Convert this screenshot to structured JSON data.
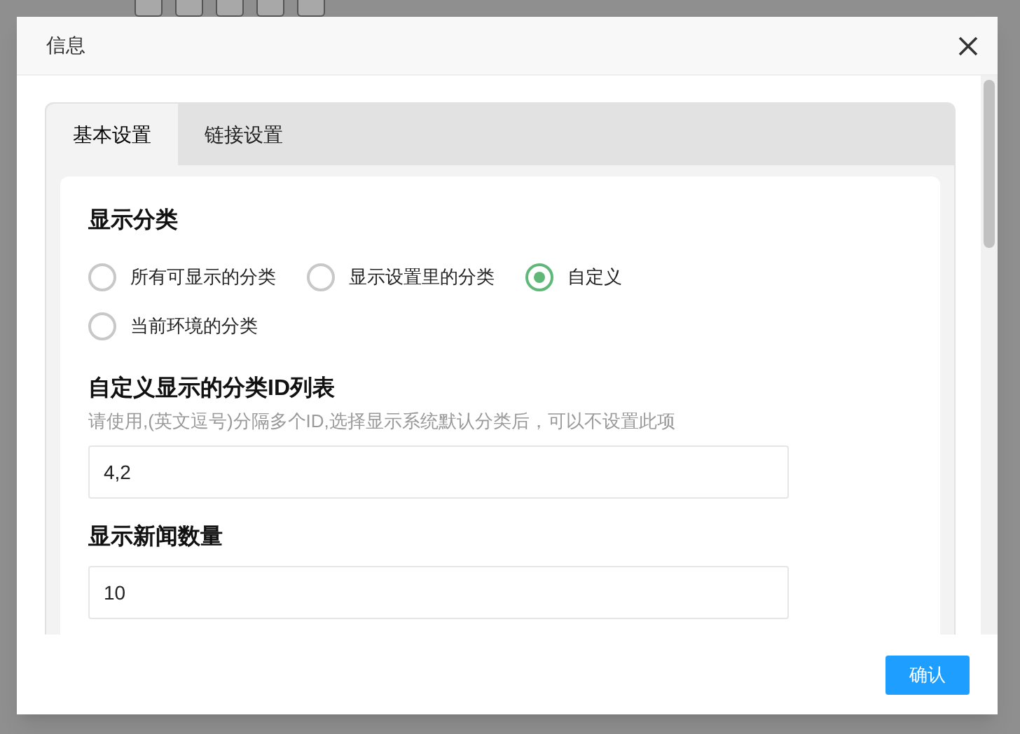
{
  "dialog": {
    "title": "信息",
    "tabs": [
      {
        "label": "基本设置",
        "selected": true
      },
      {
        "label": "链接设置",
        "selected": false
      }
    ],
    "sections": [
      {
        "kind": "radio",
        "heading": "显示分类",
        "options": [
          {
            "label": "所有可显示的分类",
            "selected": false
          },
          {
            "label": "显示设置里的分类",
            "selected": false
          },
          {
            "label": "自定义",
            "selected": true
          },
          {
            "label": "当前环境的分类",
            "selected": false
          }
        ]
      },
      {
        "kind": "input",
        "heading": "自定义显示的分类ID列表",
        "hint": "请使用,(英文逗号)分隔多个ID,选择显示系统默认分类后，可以不设置此项",
        "value": "4,2"
      },
      {
        "kind": "input",
        "heading": "显示新闻数量",
        "value": "10"
      }
    ],
    "confirm_button": "确认"
  }
}
